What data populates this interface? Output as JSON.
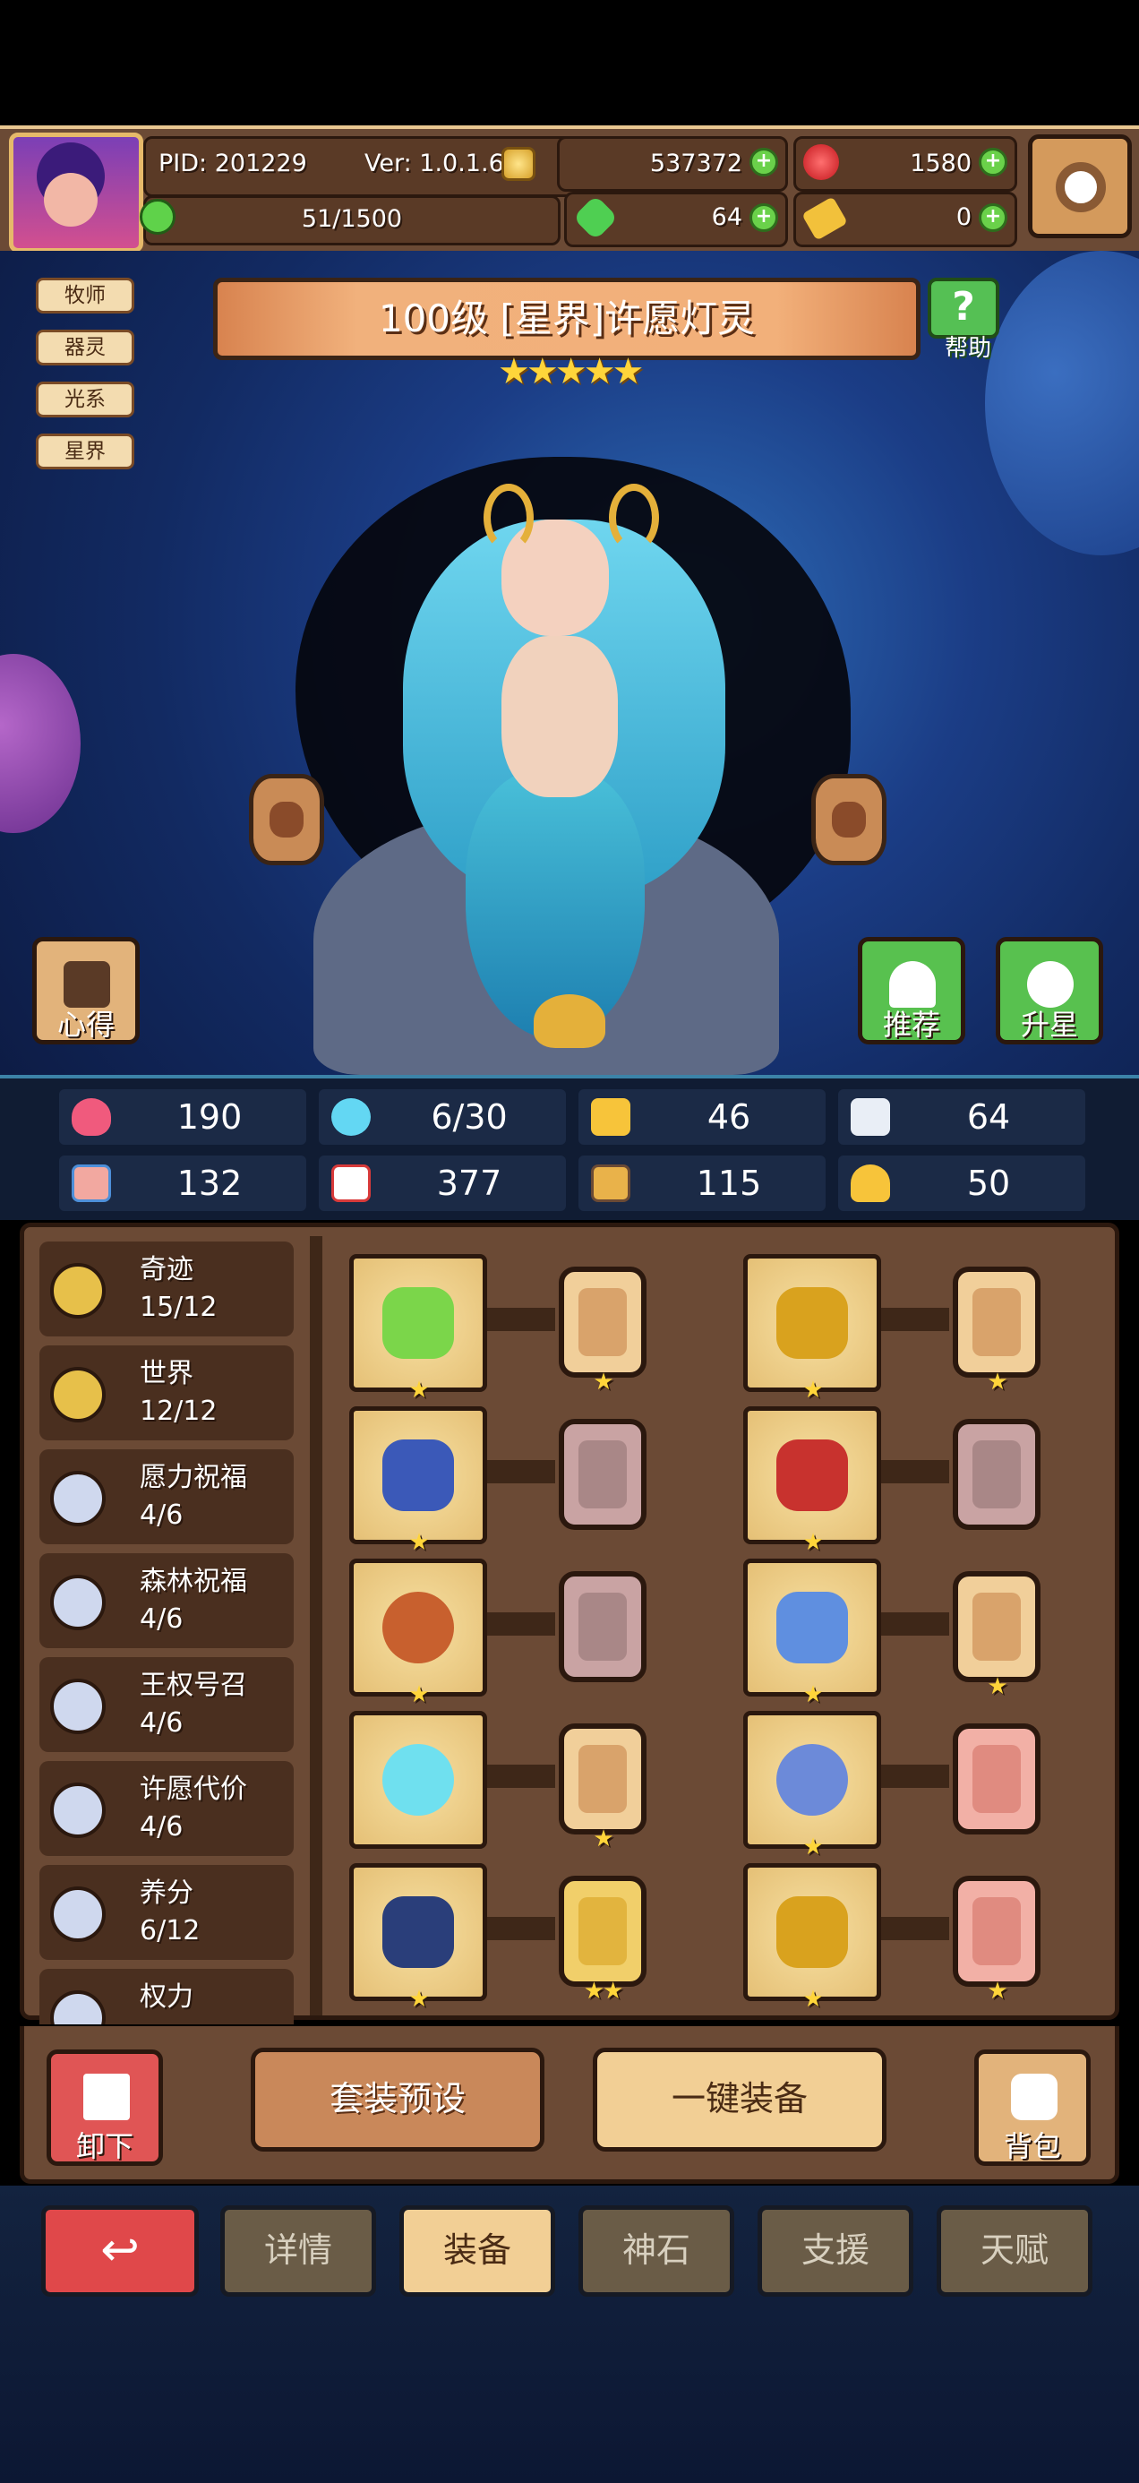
{
  "header": {
    "pid": "PID: 201229",
    "version": "Ver: 1.0.1.6",
    "stamina": "51/1500",
    "gold": "537372",
    "gems": "1580",
    "clover": "64",
    "keys": "0"
  },
  "character": {
    "title": "100级  [星界]许愿灯灵",
    "stars": "★★★★★",
    "help_label": "帮助",
    "tags": [
      "牧师",
      "器灵",
      "光系",
      "星界"
    ],
    "buttons": {
      "notes": "心得",
      "recommend": "推荐",
      "star_up": "升星"
    }
  },
  "stats": [
    {
      "icon": "heart-icon",
      "value": "190"
    },
    {
      "icon": "water-drop-icon",
      "value": "6/30"
    },
    {
      "icon": "shield-icon",
      "value": "46"
    },
    {
      "icon": "wing-icon",
      "value": "64"
    },
    {
      "icon": "fist-icon",
      "value": "132"
    },
    {
      "icon": "spellbook-icon",
      "value": "377"
    },
    {
      "icon": "armor-icon",
      "value": "115"
    },
    {
      "icon": "horseshoe-icon",
      "value": "50"
    }
  ],
  "sets": [
    {
      "name": "奇迹",
      "count": "15/12",
      "color": "#e7c04a"
    },
    {
      "name": "世界",
      "count": "12/12",
      "color": "#e7c04a"
    },
    {
      "name": "愿力祝福",
      "count": "4/6",
      "color": "#cfd8ee"
    },
    {
      "name": "森林祝福",
      "count": "4/6",
      "color": "#cfd8ee"
    },
    {
      "name": "王权号召",
      "count": "4/6",
      "color": "#cfd8ee"
    },
    {
      "name": "许愿代价",
      "count": "4/6",
      "color": "#cfd8ee"
    },
    {
      "name": "养分",
      "count": "6/12",
      "color": "#cfd8ee"
    },
    {
      "name": "权力",
      "count": "",
      "color": "#cfd8ee"
    }
  ],
  "equipment": [
    {
      "item": "staff-icon",
      "item_stars": "★",
      "card_stars": "★",
      "card_color": "#f1cf9a"
    },
    {
      "item": "crown-icon",
      "item_stars": "★",
      "card_stars": "★",
      "card_color": "#f1cf9a"
    },
    {
      "item": "magic-lamp-icon",
      "item_stars": "★",
      "card_stars": "",
      "card_color": "#c9a3a3"
    },
    {
      "item": "cape-icon",
      "item_stars": "★",
      "card_stars": "",
      "card_color": "#c9a3a3"
    },
    {
      "item": "necklace-icon",
      "item_stars": "★",
      "card_stars": "",
      "card_color": "#c9a3a3"
    },
    {
      "item": "scroll-icon",
      "item_stars": "★",
      "card_stars": "★",
      "card_color": "#f1cf9a"
    },
    {
      "item": "crystal-orb-icon",
      "item_stars": "",
      "card_stars": "★",
      "card_color": "#f1cf9a"
    },
    {
      "item": "ring-icon",
      "item_stars": "★",
      "card_stars": "",
      "card_color": "#f2b0a6"
    },
    {
      "item": "bracelet-icon",
      "item_stars": "★",
      "card_stars": "★★",
      "card_color": "#f1cf6a"
    },
    {
      "item": "boots-icon",
      "item_stars": "★",
      "card_stars": "★",
      "card_color": "#f2b0a6"
    }
  ],
  "actions": {
    "unequip": "卸下",
    "preset": "套装预设",
    "auto_equip": "一键装备",
    "bag": "背包"
  },
  "tabs": [
    "详情",
    "装备",
    "神石",
    "支援",
    "天赋"
  ]
}
